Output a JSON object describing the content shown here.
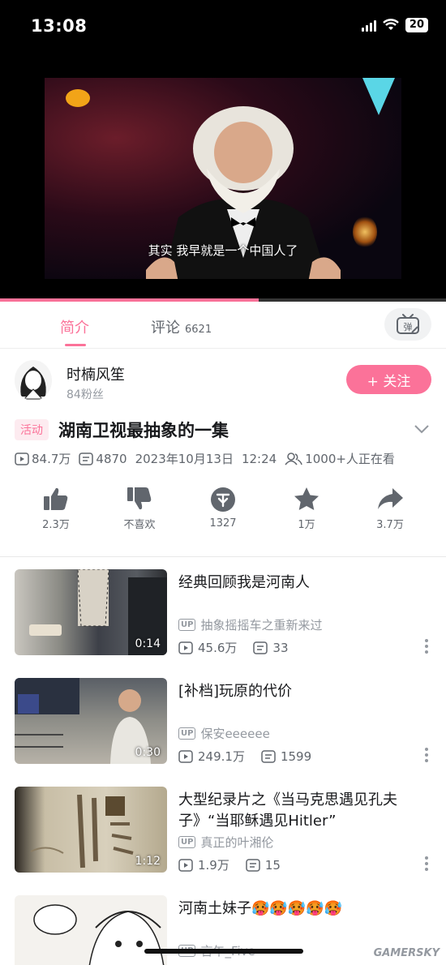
{
  "status": {
    "time": "13:08",
    "battery": "20"
  },
  "video": {
    "subtitle": "其实 我早就是一个中国人了",
    "progress": 0.58
  },
  "tabs": {
    "intro": "简介",
    "comments": "评论",
    "comment_count": "6621"
  },
  "uploader": {
    "name": "时楠风笙",
    "fans": "84粉丝",
    "follow": "+ 关注"
  },
  "video_info": {
    "tag": "活动",
    "title": "湖南卫视最抽象的一集",
    "views": "84.7万",
    "danmaku": "4870",
    "date": "2023年10月13日",
    "time": "12:24",
    "watching": "1000+人正在看"
  },
  "actions": [
    {
      "icon": "thumbs-up-icon",
      "label": "2.3万"
    },
    {
      "icon": "thumbs-down-icon",
      "label": "不喜欢"
    },
    {
      "icon": "coin-icon",
      "label": "1327"
    },
    {
      "icon": "star-icon",
      "label": "1万"
    },
    {
      "icon": "share-icon",
      "label": "3.7万"
    }
  ],
  "recommendations": [
    {
      "title": "经典回顾我是河南人",
      "up": "抽象摇摇车之重新来过",
      "views": "45.6万",
      "danmaku": "33",
      "duration": "0:14"
    },
    {
      "title": "[补档]玩原的代价",
      "up": "保安eeeeee",
      "views": "249.1万",
      "danmaku": "1599",
      "duration": "0:30"
    },
    {
      "title": "大型纪录片之《当马克思遇见孔夫子》“当耶稣遇见Hitler”",
      "up": "真正的叶湘伦",
      "views": "1.9万",
      "danmaku": "15",
      "duration": "1:12"
    },
    {
      "title": "河南土妹子🥵🥵🥵🥵🥵",
      "up": "言午_Five",
      "views": "",
      "danmaku": "",
      "duration": ""
    }
  ],
  "up_badge": "UP",
  "watermark": "GAMERSKY"
}
